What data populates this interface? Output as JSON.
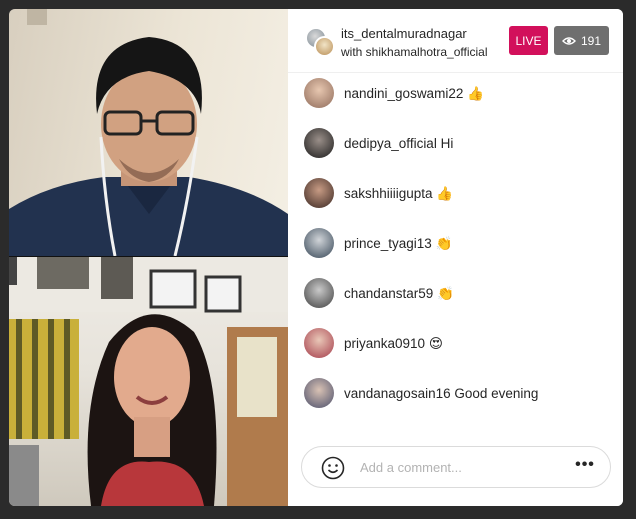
{
  "header": {
    "host_username": "its_dentalmuradnagar",
    "guest_line": "with shikhamalhotra_official",
    "live_label": "LIVE",
    "viewer_count": "191",
    "live_color": "#d2105b"
  },
  "comments": [
    {
      "user": "nandini_goswami22",
      "text": "👍"
    },
    {
      "user": "dedipya_official",
      "text": "Hi"
    },
    {
      "user": "sakshhiiiigupta",
      "text": "👍"
    },
    {
      "user": "prince_tyagi13",
      "text": "👏"
    },
    {
      "user": "chandanstar59",
      "text": "👏"
    },
    {
      "user": "priyanka0910",
      "text": "😍"
    },
    {
      "user": "vandanagosain16",
      "text": "Good evening"
    }
  ],
  "composer": {
    "placeholder": "Add a comment...",
    "emoji_icon": "smile-icon",
    "more_icon": "more-options-icon"
  }
}
